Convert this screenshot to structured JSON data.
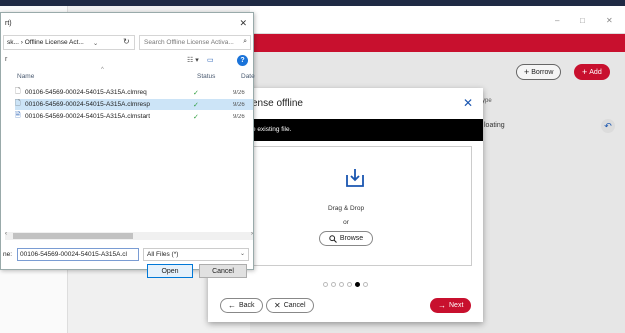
{
  "background_app": {
    "window_controls": {
      "minimize": "–",
      "maximize": "□",
      "close": "✕"
    },
    "toolbar": {
      "borrow_label": "Borrow",
      "add_label": "Add"
    },
    "table": {
      "type_header": "ype",
      "row_type": "loating"
    }
  },
  "modal": {
    "title": "ense offline",
    "info_text": "e existing file.",
    "dropzone": {
      "drag_text": "Drag & Drop",
      "or_text": "or",
      "browse_label": "Browse"
    },
    "steps": {
      "count": 6,
      "active_index": 4
    },
    "footer": {
      "back_label": "Back",
      "cancel_label": "Cancel",
      "next_label": "Next"
    }
  },
  "file_dialog": {
    "title": "rt)",
    "address_path": "sk... › Offline License Act...",
    "search_placeholder": "Search Offline License Activa...",
    "columns": {
      "name": "Name",
      "status": "Status",
      "date": "Date"
    },
    "files": [
      {
        "name": "00106-54569-00024-54015-A315A.clmreq",
        "status": "✓",
        "date": "9/26",
        "selected": false
      },
      {
        "name": "00106-54569-00024-54015-A315A.clmresp",
        "status": "✓",
        "date": "9/26",
        "selected": true
      },
      {
        "name": "00106-54569-00024-54015-A315A.clmstart",
        "status": "✓",
        "date": "9/26",
        "selected": false
      }
    ],
    "filename_label": "ne:",
    "filename_value": "00106-54569-00024-54015-A315A.cl",
    "filetype_value": "All Files (*)",
    "open_label": "Open",
    "cancel_label": "Cancel"
  },
  "colors": {
    "brand_red": "#c8102e",
    "accent_blue": "#1a56b0",
    "selection": "#cce4f7"
  }
}
